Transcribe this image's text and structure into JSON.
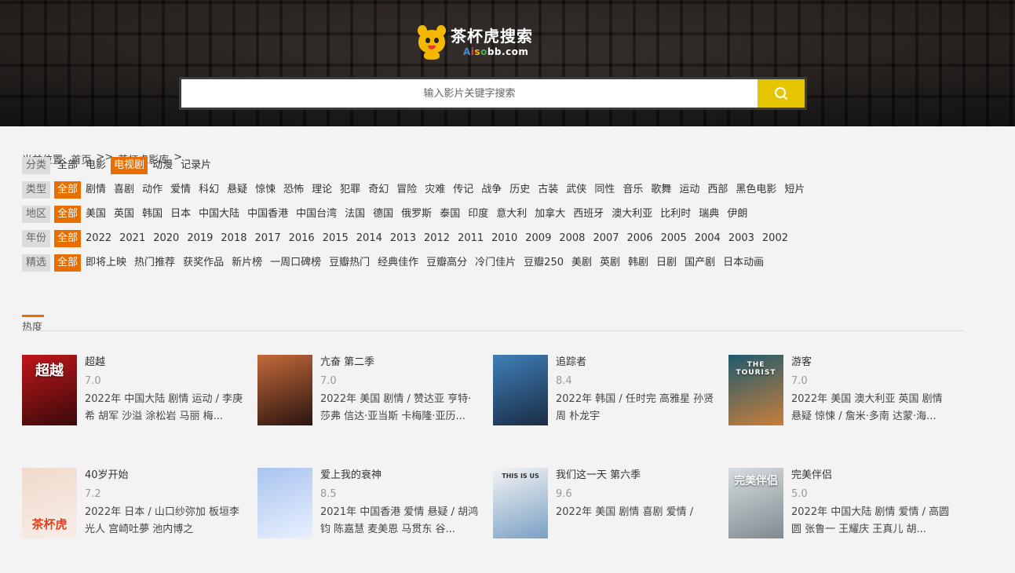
{
  "header": {
    "logo_title": "茶杯虎搜索",
    "logo_domain_parts": [
      "A",
      "i",
      "s",
      "o",
      "bb.com"
    ],
    "search_placeholder": "输入影片关键字搜索"
  },
  "breadcrumb": {
    "prefix": "当前位置:",
    "items": [
      "首页",
      ">>",
      "茶杯虎影库",
      ">"
    ]
  },
  "filters": [
    {
      "label": "分类",
      "items": [
        "全部",
        "电影",
        "电视剧",
        "动漫",
        "记录片"
      ],
      "active": 2
    },
    {
      "label": "类型",
      "items": [
        "全部",
        "剧情",
        "喜剧",
        "动作",
        "爱情",
        "科幻",
        "悬疑",
        "惊悚",
        "恐怖",
        "理论",
        "犯罪",
        "奇幻",
        "冒险",
        "灾难",
        "传记",
        "战争",
        "历史",
        "古装",
        "武侠",
        "同性",
        "音乐",
        "歌舞",
        "运动",
        "西部",
        "黑色电影",
        "短片"
      ],
      "active": 0
    },
    {
      "label": "地区",
      "items": [
        "全部",
        "美国",
        "英国",
        "韩国",
        "日本",
        "中国大陆",
        "中国香港",
        "中国台湾",
        "法国",
        "德国",
        "俄罗斯",
        "泰国",
        "印度",
        "意大利",
        "加拿大",
        "西班牙",
        "澳大利亚",
        "比利时",
        "瑞典",
        "伊朗"
      ],
      "active": 0
    },
    {
      "label": "年份",
      "items": [
        "全部",
        "2022",
        "2021",
        "2020",
        "2019",
        "2018",
        "2017",
        "2016",
        "2015",
        "2014",
        "2013",
        "2012",
        "2011",
        "2010",
        "2009",
        "2008",
        "2007",
        "2006",
        "2005",
        "2004",
        "2003",
        "2002"
      ],
      "active": 0
    },
    {
      "label": "精选",
      "items": [
        "全部",
        "即将上映",
        "热门推荐",
        "获奖作品",
        "新片榜",
        "一周口碑榜",
        "豆瓣热门",
        "经典佳作",
        "豆瓣高分",
        "冷门佳片",
        "豆瓣250",
        "美剧",
        "英剧",
        "韩剧",
        "日剧",
        "国产剧",
        "日本动画"
      ],
      "active": 0
    }
  ],
  "sort": {
    "label": "热度"
  },
  "cards": [
    {
      "title": "超越",
      "score": "7.0",
      "desc": "2022年 中国大陆 剧情 运动 / 李庚希 胡军 沙溢 涂松岩 马丽 梅...",
      "poster_text": "超越",
      "colors": [
        "#c0161b",
        "#3a0a0a"
      ]
    },
    {
      "title": "亢奋 第二季",
      "score": "7.0",
      "desc": "2022年 美国 剧情 / 赞达亚 亨特·莎弗 信达·亚当斯 卡梅隆·亚历...",
      "poster_text": "",
      "colors": [
        "#c26a3a",
        "#2a1410"
      ]
    },
    {
      "title": "追踪者",
      "score": "8.4",
      "desc": "2022年 韩国 / 任时完 高雅星 孙贤周 朴龙宇",
      "poster_text": "",
      "colors": [
        "#3f7fb8",
        "#1a2c44"
      ]
    },
    {
      "title": "游客",
      "score": "7.0",
      "desc": "2022年 美国 澳大利亚 英国 剧情 悬疑 惊悚 / 詹米·多南 达蒙·海...",
      "poster_text": "THE TOURIST",
      "colors": [
        "#1f5a6e",
        "#c87f3a"
      ]
    },
    {
      "title": "40岁开始",
      "score": "7.2",
      "desc": "2022年 日本 / 山口纱弥加 板垣李光人 宫崎吐夢 池内博之",
      "poster_text": "茶杯虎",
      "colors": [
        "#f2d9cc",
        "#f6eee8"
      ]
    },
    {
      "title": "爱上我的衰神",
      "score": "8.5",
      "desc": "2021年 中国香港 爱情 悬疑 / 胡鸿钧 陈嘉慧 麦美恩 马贯东 谷...",
      "poster_text": "",
      "colors": [
        "#a9c4ee",
        "#e9f0ff"
      ]
    },
    {
      "title": "我们这一天 第六季",
      "score": "9.6",
      "desc": "2022年 美国 剧情 喜剧 爱情 /",
      "poster_text": "THIS IS US",
      "colors": [
        "#f4f4f4",
        "#7aa0c4"
      ]
    },
    {
      "title": "完美伴侣",
      "score": "5.0",
      "desc": "2022年 中国大陆 剧情 爱情 / 高圆圆 张鲁一 王耀庆 王真儿 胡...",
      "poster_text": "完美伴侣",
      "colors": [
        "#d7dde0",
        "#7f8a90"
      ]
    }
  ]
}
